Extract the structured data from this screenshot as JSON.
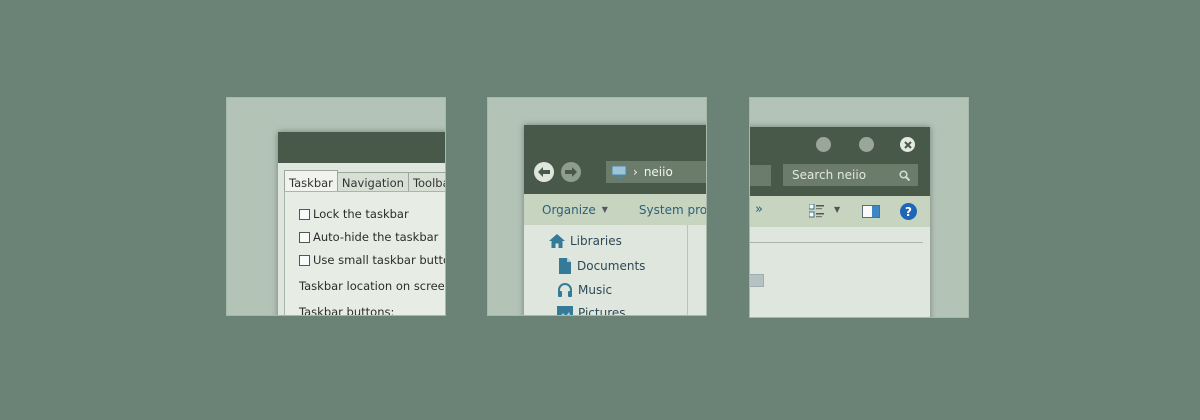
{
  "taskbar_dialog": {
    "tabs": [
      "Taskbar",
      "Navigation",
      "Toolbars"
    ],
    "options": [
      "Lock the taskbar",
      "Auto-hide the taskbar",
      "Use small taskbar buttons"
    ],
    "location_label": "Taskbar location on screen:",
    "buttons_label": "Taskbar buttons:"
  },
  "explorer": {
    "address": {
      "icon": "computer-icon",
      "separator": "›",
      "path": "neiio"
    },
    "command_bar": {
      "organize": "Organize",
      "system_properties": "System proper"
    },
    "tree": [
      {
        "icon": "home-icon",
        "label": "Libraries"
      },
      {
        "icon": "document-icon",
        "label": "Documents"
      },
      {
        "icon": "headphones-icon",
        "label": "Music"
      },
      {
        "icon": "picture-icon",
        "label": "Pictures"
      }
    ]
  },
  "window_controls": {
    "search_placeholder": "Search neiio",
    "more_label": "»",
    "help_label": "?",
    "accent_help": "#1e67b8"
  },
  "colors": {
    "background": "#6b8277",
    "titlebar": "#485949",
    "commandbar": "#c6d4c0"
  }
}
